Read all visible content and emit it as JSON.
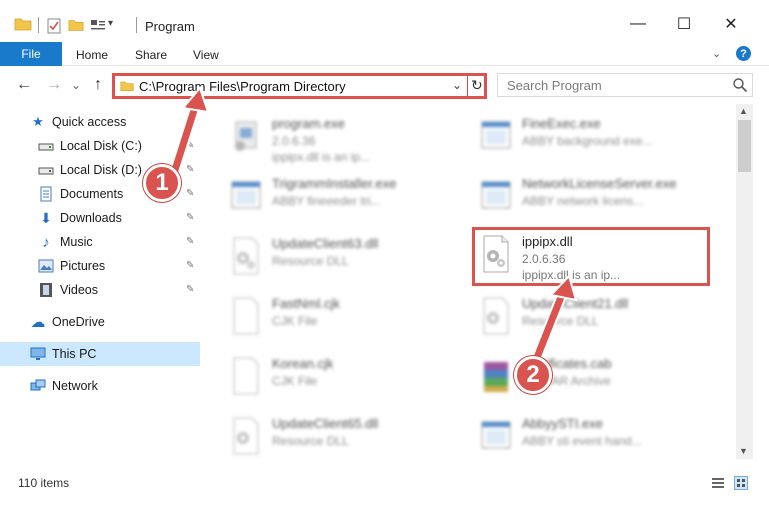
{
  "window": {
    "title": "Program",
    "minimize_glyph": "—",
    "maximize_glyph": "☐",
    "close_glyph": "✕"
  },
  "ribbon": {
    "file_tab": "File",
    "tabs": [
      "Home",
      "Share",
      "View"
    ],
    "help_glyph": "?",
    "expand_glyph": "⌄"
  },
  "nav": {
    "back_glyph": "←",
    "forward_glyph": "→",
    "recent_glyph": "⌄",
    "up_glyph": "↑",
    "address": "C:\\Program Files\\Program Directory",
    "address_drop_glyph": "⌄",
    "refresh_glyph": "↻",
    "search_placeholder": "Search Program"
  },
  "sidebar": {
    "items": [
      {
        "label": "Quick access",
        "icon": "star-icon",
        "glyph": "★",
        "color": "#1f6fc5"
      },
      {
        "label": "Local Disk (C:)",
        "icon": "drive-icon",
        "glyph": "▭",
        "color": "#555555",
        "pinned": true
      },
      {
        "label": "Local Disk (D:)",
        "icon": "drive-icon",
        "glyph": "▭",
        "color": "#555555",
        "pinned": true
      },
      {
        "label": "Documents",
        "icon": "documents-icon",
        "glyph": "▤",
        "color": "#4a7bbf",
        "pinned": true
      },
      {
        "label": "Downloads",
        "icon": "download-icon",
        "glyph": "⬇",
        "color": "#1f6fc5",
        "pinned": true
      },
      {
        "label": "Music",
        "icon": "music-icon",
        "glyph": "♪",
        "color": "#1f6fc5",
        "pinned": true
      },
      {
        "label": "Pictures",
        "icon": "pictures-icon",
        "glyph": "▣",
        "color": "#4a7bbf",
        "pinned": true
      },
      {
        "label": "Videos",
        "icon": "videos-icon",
        "glyph": "▦",
        "color": "#444444",
        "pinned": true
      },
      {
        "label": "OneDrive",
        "icon": "cloud-icon",
        "glyph": "☁",
        "color": "#1f6fc5"
      },
      {
        "label": "This PC",
        "icon": "computer-icon",
        "glyph": "▭",
        "color": "#1f6fc5"
      },
      {
        "label": "Network",
        "icon": "network-icon",
        "glyph": "⧉",
        "color": "#1f6fc5"
      }
    ],
    "pin_glyph": "📌"
  },
  "files": [
    {
      "name": "program.exe",
      "line1": "2.0.6.36",
      "line2": "ippipx.dll is an ip...",
      "icon": "exe-setup-icon",
      "blurred": true
    },
    {
      "name": "FineExec.exe",
      "line1": "ABBY background exe...",
      "line2": "",
      "icon": "app-window-icon",
      "blurred": true
    },
    {
      "name": "TrigrammInstaller.exe",
      "line1": "ABBY fineeeder tri...",
      "line2": "",
      "icon": "app-window-icon",
      "blurred": true
    },
    {
      "name": "NetworkLicenseServer.exe",
      "line1": "ABBY network licens...",
      "line2": "",
      "icon": "app-window-icon",
      "blurred": true
    },
    {
      "name": "UpdateClient63.dll",
      "line1": "Resource DLL",
      "line2": "",
      "icon": "dll-gear-icon",
      "blurred": true
    },
    {
      "name": "ippipx.dll",
      "line1": "2.0.6.36",
      "line2": "ippipx.dll is an ip...",
      "icon": "dll-gear-icon",
      "blurred": false
    },
    {
      "name": "FastNml.cjk",
      "line1": "CJK File",
      "line2": "",
      "icon": "blank-file-icon",
      "blurred": true
    },
    {
      "name": "UpdateClient21.dll",
      "line1": "Resource DLL",
      "line2": "",
      "icon": "dll-gear-icon",
      "blurred": true
    },
    {
      "name": "Korean.cjk",
      "line1": "CJK File",
      "line2": "",
      "icon": "blank-file-icon",
      "blurred": true
    },
    {
      "name": "Certificates.cab",
      "line1": "WinRAR Archive",
      "line2": "",
      "icon": "archive-icon",
      "blurred": true
    },
    {
      "name": "UpdateClient65.dll",
      "line1": "Resource DLL",
      "line2": "",
      "icon": "dll-gear-icon",
      "blurred": true
    },
    {
      "name": "AbbyySTI.exe",
      "line1": "ABBY sti event hand...",
      "line2": "",
      "icon": "app-window-icon",
      "blurred": true
    }
  ],
  "status": {
    "item_count": "110 items"
  },
  "callouts": {
    "step1": "1",
    "step2": "2"
  },
  "colors": {
    "accent": "#1979ca",
    "annotation_red": "#d9534f",
    "selected_bg": "#cce8ff"
  }
}
